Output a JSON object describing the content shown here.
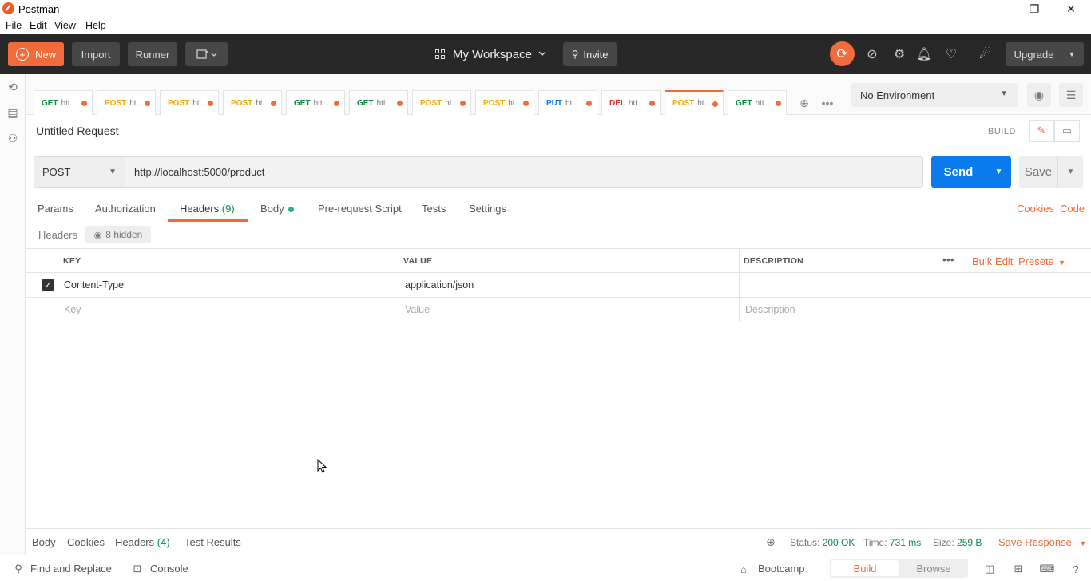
{
  "window": {
    "title": "Postman",
    "minimize": "—",
    "restore": "❐",
    "close": "✕"
  },
  "menu": [
    "File",
    "Edit",
    "View",
    "Help"
  ],
  "header": {
    "new_label": "New",
    "import_label": "Import",
    "runner_label": "Runner",
    "workspace_label": "My Workspace",
    "invite_label": "Invite",
    "upgrade_label": "Upgrade"
  },
  "tabs": [
    {
      "method": "GET",
      "label": "htt..."
    },
    {
      "method": "POST",
      "label": "ht..."
    },
    {
      "method": "POST",
      "label": "ht..."
    },
    {
      "method": "POST",
      "label": "ht..."
    },
    {
      "method": "GET",
      "label": "htt..."
    },
    {
      "method": "GET",
      "label": "htt..."
    },
    {
      "method": "POST",
      "label": "ht..."
    },
    {
      "method": "POST",
      "label": "ht..."
    },
    {
      "method": "PUT",
      "label": "htt..."
    },
    {
      "method": "DEL",
      "label": "htt..."
    },
    {
      "method": "POST",
      "label": "ht..."
    },
    {
      "method": "GET",
      "label": "htt..."
    }
  ],
  "environment": {
    "selected": "No Environment"
  },
  "request": {
    "name": "Untitled Request",
    "mode_label": "BUILD",
    "method": "POST",
    "url": "http://localhost:5000/product",
    "send_label": "Send",
    "save_label": "Save"
  },
  "request_tabs": {
    "params": "Params",
    "authorization": "Authorization",
    "headers": "Headers",
    "headers_count": "(9)",
    "body": "Body",
    "pre_request": "Pre-request Script",
    "tests": "Tests",
    "settings": "Settings",
    "cookies": "Cookies",
    "code": "Code"
  },
  "headers_panel": {
    "label": "Headers",
    "hidden_label": "8 hidden",
    "columns": {
      "key": "KEY",
      "value": "VALUE",
      "description": "DESCRIPTION"
    },
    "bulk_edit": "Bulk Edit",
    "presets": "Presets",
    "rows": [
      {
        "key": "Content-Type",
        "value": "application/json",
        "description": ""
      }
    ],
    "placeholders": {
      "key": "Key",
      "value": "Value",
      "description": "Description"
    }
  },
  "response": {
    "body": "Body",
    "cookies": "Cookies",
    "headers": "Headers",
    "headers_count": "(4)",
    "test_results": "Test Results",
    "status_label": "Status:",
    "status_value": "200 OK",
    "time_label": "Time:",
    "time_value": "731 ms",
    "size_label": "Size:",
    "size_value": "259 B",
    "save_response": "Save Response"
  },
  "statusbar": {
    "find_replace": "Find and Replace",
    "console": "Console",
    "bootcamp": "Bootcamp",
    "build": "Build",
    "browse": "Browse"
  },
  "colors": {
    "accent": "#f26b3a",
    "send": "#097bed",
    "header_bg": "#282828",
    "status_ok": "#0c8a45"
  }
}
